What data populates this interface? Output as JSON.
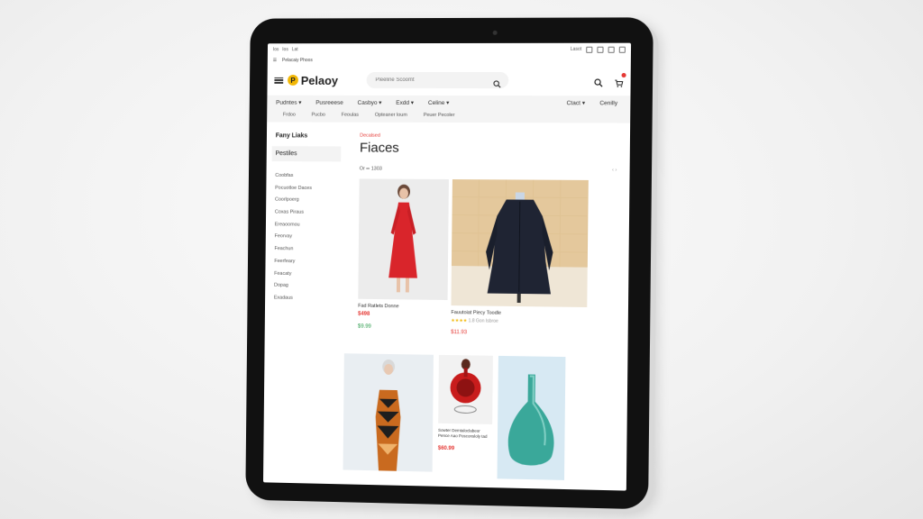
{
  "status": {
    "left_items": [
      "Ios",
      "Ios",
      "Lat"
    ],
    "tab_title": "Pelacaiy Phoos",
    "right_text": "Lasot"
  },
  "header": {
    "logo_text": "Pelaoy",
    "logo_letter": "P",
    "search_placeholder": "Pleeline Scoomt"
  },
  "nav": {
    "row1": [
      "Pudntes",
      "Pusreeese",
      "Casbyo",
      "Exdd",
      "Celine"
    ],
    "right": [
      "Ctact",
      "Cenilly"
    ],
    "row2": [
      "Frdoo",
      "Pucbo",
      "Feoulas",
      "Opteaner loum",
      "Peuer Pecoler"
    ]
  },
  "sidebar": {
    "title": "Fany Liaks",
    "selected": "Pestiles",
    "items": [
      "Coobfas",
      "Pocuotloe Daces",
      "Coorlpoerg",
      "Coxas Piraus",
      "Ereaoomou",
      "Feorvay",
      "Feachun",
      "Feerfeary",
      "Feacaty",
      "Dopag",
      "Exadaus"
    ]
  },
  "main": {
    "breadcrumb": "Decalsed",
    "title": "Fiaces",
    "sort_label": "Or ∞ 1303",
    "pager": "‹ ›",
    "products": [
      {
        "name": "Fad Ratlets Donne",
        "price": "$498",
        "price2": "$9.99"
      },
      {
        "name": "Fauutoiat Piecy Toodle",
        "rating_stars": "★★★★",
        "rating_count": "1.8 Gon Isbroe",
        "price": "$11.93"
      },
      {
        "name": "",
        "price": ""
      },
      {
        "name": "Sowter Demtaloclabeor Pence Aao Posconsloly tad",
        "price": "$60.99"
      },
      {
        "name": "",
        "price": ""
      }
    ]
  },
  "colors": {
    "accent": "#e53935",
    "logo": "#f2b705",
    "price_green": "#2e9e4f",
    "nav_bg": "#f4f4f4"
  }
}
